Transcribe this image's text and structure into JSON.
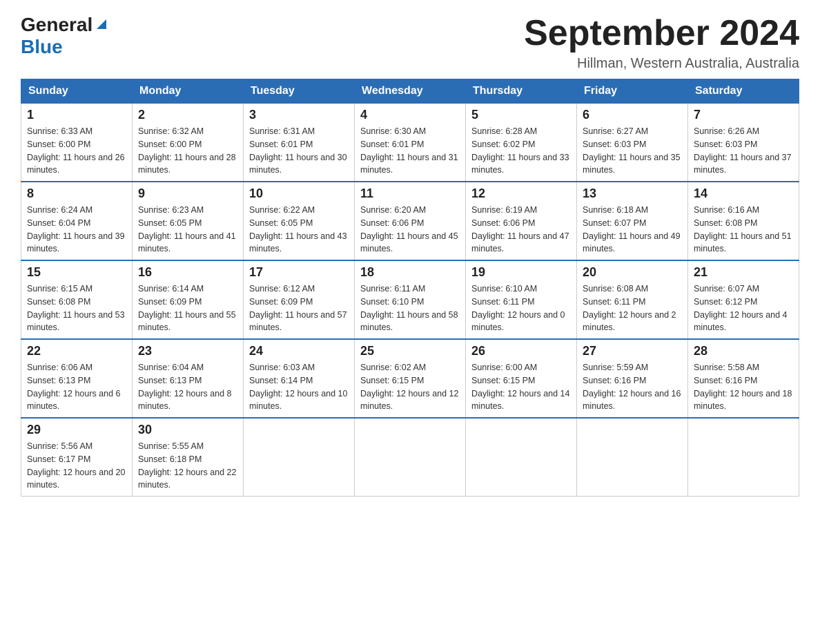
{
  "header": {
    "logo_general": "General",
    "logo_blue": "Blue",
    "title": "September 2024",
    "subtitle": "Hillman, Western Australia, Australia"
  },
  "days_of_week": [
    "Sunday",
    "Monday",
    "Tuesday",
    "Wednesday",
    "Thursday",
    "Friday",
    "Saturday"
  ],
  "weeks": [
    [
      {
        "day": "1",
        "sunrise": "Sunrise: 6:33 AM",
        "sunset": "Sunset: 6:00 PM",
        "daylight": "Daylight: 11 hours and 26 minutes."
      },
      {
        "day": "2",
        "sunrise": "Sunrise: 6:32 AM",
        "sunset": "Sunset: 6:00 PM",
        "daylight": "Daylight: 11 hours and 28 minutes."
      },
      {
        "day": "3",
        "sunrise": "Sunrise: 6:31 AM",
        "sunset": "Sunset: 6:01 PM",
        "daylight": "Daylight: 11 hours and 30 minutes."
      },
      {
        "day": "4",
        "sunrise": "Sunrise: 6:30 AM",
        "sunset": "Sunset: 6:01 PM",
        "daylight": "Daylight: 11 hours and 31 minutes."
      },
      {
        "day": "5",
        "sunrise": "Sunrise: 6:28 AM",
        "sunset": "Sunset: 6:02 PM",
        "daylight": "Daylight: 11 hours and 33 minutes."
      },
      {
        "day": "6",
        "sunrise": "Sunrise: 6:27 AM",
        "sunset": "Sunset: 6:03 PM",
        "daylight": "Daylight: 11 hours and 35 minutes."
      },
      {
        "day": "7",
        "sunrise": "Sunrise: 6:26 AM",
        "sunset": "Sunset: 6:03 PM",
        "daylight": "Daylight: 11 hours and 37 minutes."
      }
    ],
    [
      {
        "day": "8",
        "sunrise": "Sunrise: 6:24 AM",
        "sunset": "Sunset: 6:04 PM",
        "daylight": "Daylight: 11 hours and 39 minutes."
      },
      {
        "day": "9",
        "sunrise": "Sunrise: 6:23 AM",
        "sunset": "Sunset: 6:05 PM",
        "daylight": "Daylight: 11 hours and 41 minutes."
      },
      {
        "day": "10",
        "sunrise": "Sunrise: 6:22 AM",
        "sunset": "Sunset: 6:05 PM",
        "daylight": "Daylight: 11 hours and 43 minutes."
      },
      {
        "day": "11",
        "sunrise": "Sunrise: 6:20 AM",
        "sunset": "Sunset: 6:06 PM",
        "daylight": "Daylight: 11 hours and 45 minutes."
      },
      {
        "day": "12",
        "sunrise": "Sunrise: 6:19 AM",
        "sunset": "Sunset: 6:06 PM",
        "daylight": "Daylight: 11 hours and 47 minutes."
      },
      {
        "day": "13",
        "sunrise": "Sunrise: 6:18 AM",
        "sunset": "Sunset: 6:07 PM",
        "daylight": "Daylight: 11 hours and 49 minutes."
      },
      {
        "day": "14",
        "sunrise": "Sunrise: 6:16 AM",
        "sunset": "Sunset: 6:08 PM",
        "daylight": "Daylight: 11 hours and 51 minutes."
      }
    ],
    [
      {
        "day": "15",
        "sunrise": "Sunrise: 6:15 AM",
        "sunset": "Sunset: 6:08 PM",
        "daylight": "Daylight: 11 hours and 53 minutes."
      },
      {
        "day": "16",
        "sunrise": "Sunrise: 6:14 AM",
        "sunset": "Sunset: 6:09 PM",
        "daylight": "Daylight: 11 hours and 55 minutes."
      },
      {
        "day": "17",
        "sunrise": "Sunrise: 6:12 AM",
        "sunset": "Sunset: 6:09 PM",
        "daylight": "Daylight: 11 hours and 57 minutes."
      },
      {
        "day": "18",
        "sunrise": "Sunrise: 6:11 AM",
        "sunset": "Sunset: 6:10 PM",
        "daylight": "Daylight: 11 hours and 58 minutes."
      },
      {
        "day": "19",
        "sunrise": "Sunrise: 6:10 AM",
        "sunset": "Sunset: 6:11 PM",
        "daylight": "Daylight: 12 hours and 0 minutes."
      },
      {
        "day": "20",
        "sunrise": "Sunrise: 6:08 AM",
        "sunset": "Sunset: 6:11 PM",
        "daylight": "Daylight: 12 hours and 2 minutes."
      },
      {
        "day": "21",
        "sunrise": "Sunrise: 6:07 AM",
        "sunset": "Sunset: 6:12 PM",
        "daylight": "Daylight: 12 hours and 4 minutes."
      }
    ],
    [
      {
        "day": "22",
        "sunrise": "Sunrise: 6:06 AM",
        "sunset": "Sunset: 6:13 PM",
        "daylight": "Daylight: 12 hours and 6 minutes."
      },
      {
        "day": "23",
        "sunrise": "Sunrise: 6:04 AM",
        "sunset": "Sunset: 6:13 PM",
        "daylight": "Daylight: 12 hours and 8 minutes."
      },
      {
        "day": "24",
        "sunrise": "Sunrise: 6:03 AM",
        "sunset": "Sunset: 6:14 PM",
        "daylight": "Daylight: 12 hours and 10 minutes."
      },
      {
        "day": "25",
        "sunrise": "Sunrise: 6:02 AM",
        "sunset": "Sunset: 6:15 PM",
        "daylight": "Daylight: 12 hours and 12 minutes."
      },
      {
        "day": "26",
        "sunrise": "Sunrise: 6:00 AM",
        "sunset": "Sunset: 6:15 PM",
        "daylight": "Daylight: 12 hours and 14 minutes."
      },
      {
        "day": "27",
        "sunrise": "Sunrise: 5:59 AM",
        "sunset": "Sunset: 6:16 PM",
        "daylight": "Daylight: 12 hours and 16 minutes."
      },
      {
        "day": "28",
        "sunrise": "Sunrise: 5:58 AM",
        "sunset": "Sunset: 6:16 PM",
        "daylight": "Daylight: 12 hours and 18 minutes."
      }
    ],
    [
      {
        "day": "29",
        "sunrise": "Sunrise: 5:56 AM",
        "sunset": "Sunset: 6:17 PM",
        "daylight": "Daylight: 12 hours and 20 minutes."
      },
      {
        "day": "30",
        "sunrise": "Sunrise: 5:55 AM",
        "sunset": "Sunset: 6:18 PM",
        "daylight": "Daylight: 12 hours and 22 minutes."
      },
      null,
      null,
      null,
      null,
      null
    ]
  ]
}
